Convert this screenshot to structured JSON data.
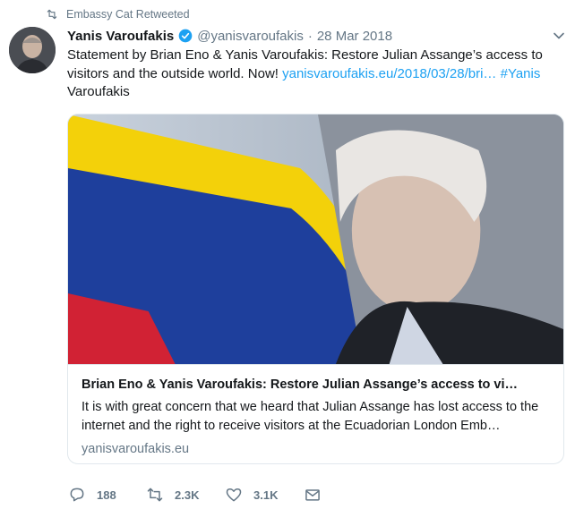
{
  "retweet_context": {
    "label": "Embassy Cat Retweeted"
  },
  "author": {
    "name": "Yanis Varoufakis",
    "handle": "@yanisvaroufakis",
    "separator": "·",
    "date": "28 Mar 2018"
  },
  "tweet": {
    "text_before_link": "Statement by Brian Eno & Yanis Varoufakis: Restore Julian Assange’s access to visitors and the outside world. Now! ",
    "link_text": "yanisvaroufakis.eu/2018/03/28/bri…",
    "hashtag": "#Yanis",
    "text_after": " Varoufakis"
  },
  "card": {
    "title": "Brian Eno & Yanis Varoufakis: Restore Julian Assange’s access to vi…",
    "description": "It is with great concern that we heard that Julian Assange has lost access to the internet and the right to receive visitors at the Ecuadorian London Emb…",
    "domain": "yanisvaroufakis.eu"
  },
  "actions": {
    "replies": "188",
    "retweets": "2.3K",
    "likes": "3.1K"
  },
  "icons": {
    "retweet": "retweet-icon",
    "verified": "verified-badge-icon",
    "reply": "reply-icon",
    "like": "heart-icon",
    "dm": "envelope-icon",
    "menu": "chevron-down-icon"
  },
  "colors": {
    "link": "#1da1f2",
    "muted": "#657786",
    "text": "#14171a",
    "border": "#e1e8ed"
  }
}
